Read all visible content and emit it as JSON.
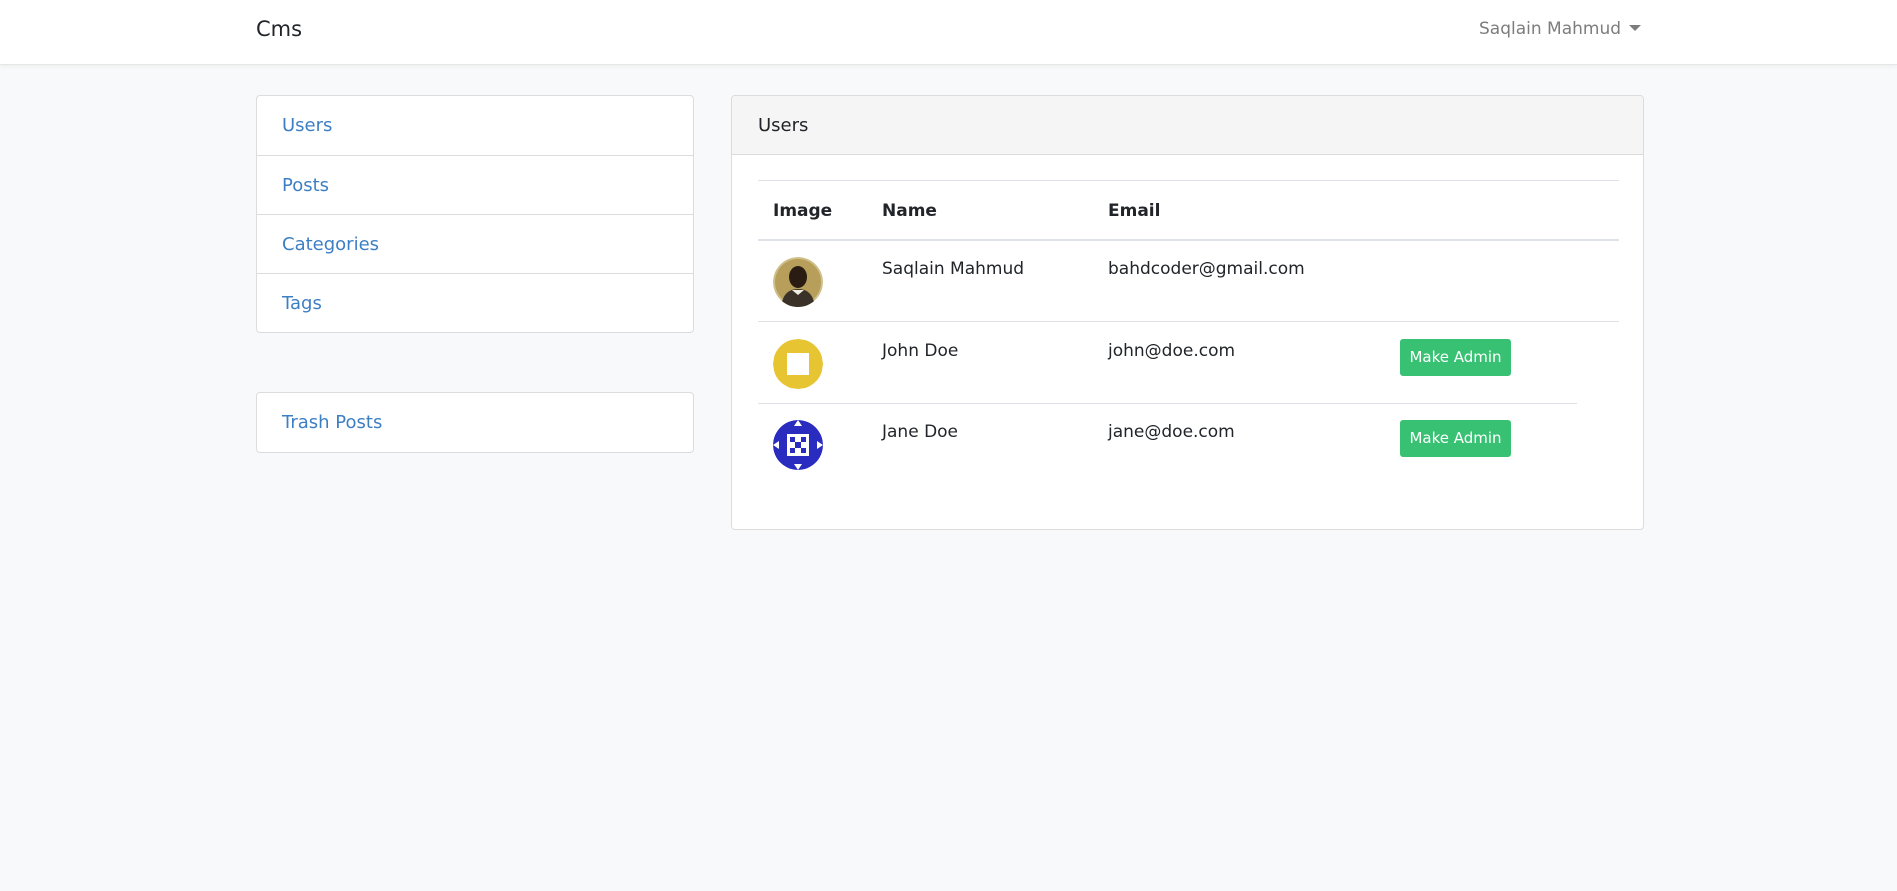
{
  "navbar": {
    "brand": "Cms",
    "user_name": "Saqlain Mahmud"
  },
  "sidebar": {
    "items": [
      {
        "label": "Users"
      },
      {
        "label": "Posts"
      },
      {
        "label": "Categories"
      },
      {
        "label": "Tags"
      }
    ],
    "trash": {
      "label": "Trash Posts"
    }
  },
  "main": {
    "card_title": "Users",
    "table": {
      "headers": [
        "Image",
        "Name",
        "Email",
        ""
      ],
      "rows": [
        {
          "name": "Saqlain Mahmud",
          "email": "bahdcoder@gmail.com",
          "action": ""
        },
        {
          "name": "John Doe",
          "email": "john@doe.com",
          "action": "Make Admin"
        },
        {
          "name": "Jane Doe",
          "email": "jane@doe.com",
          "action": "Make Admin"
        }
      ]
    }
  },
  "colors": {
    "link": "#3d7fc4",
    "success": "#38c172",
    "identicon_yellow": "#e7c431",
    "identicon_blue": "#2a2bbf"
  },
  "icons": {
    "user_menu": "caret-down-icon",
    "avatar_1": "user-photo",
    "avatar_2": "identicon-yellow",
    "avatar_3": "identicon-blue"
  }
}
